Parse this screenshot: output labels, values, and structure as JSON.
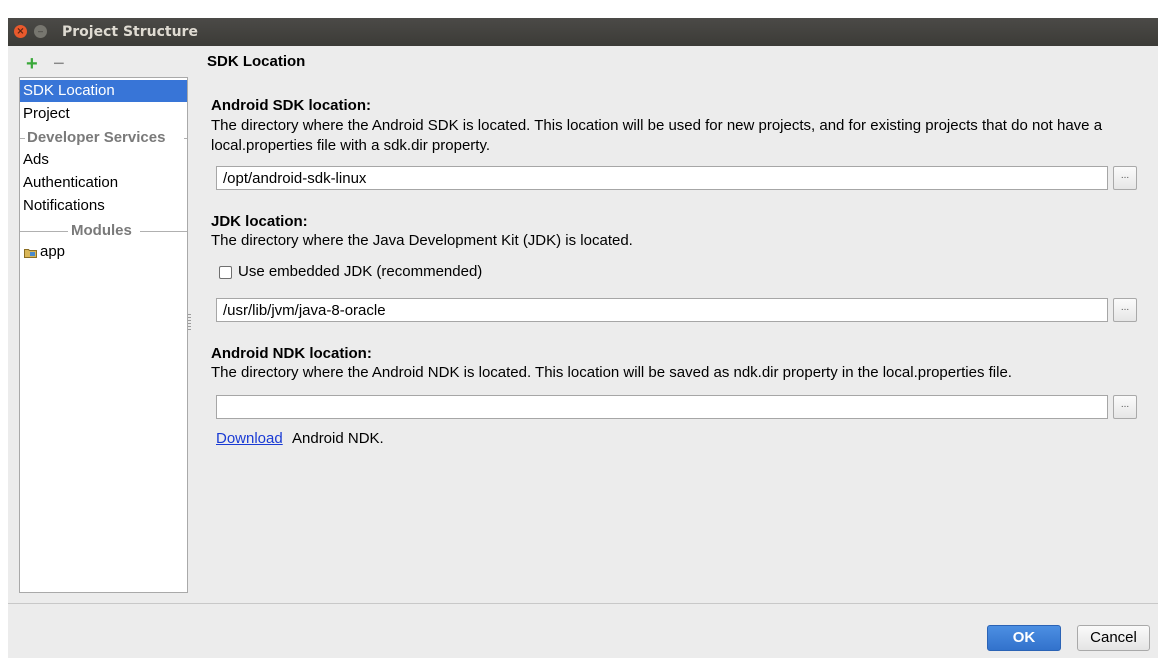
{
  "window": {
    "title": "Project Structure"
  },
  "toolbar": {
    "add": "+",
    "remove": "−"
  },
  "sidebar": {
    "items": [
      "SDK Location",
      "Project"
    ],
    "developer_services_header": "Developer Services",
    "service_items": [
      "Ads",
      "Authentication",
      "Notifications"
    ],
    "modules_header": "Modules",
    "modules": [
      "app"
    ]
  },
  "main": {
    "heading": "SDK Location",
    "android_sdk": {
      "label": "Android SDK location:",
      "description": "The directory where the Android SDK is located. This location will be used for new projects, and for existing projects that do not have a local.properties file with a sdk.dir property.",
      "value": "/opt/android-sdk-linux",
      "browse": "..."
    },
    "jdk": {
      "label": "JDK location:",
      "description": "The directory where the Java Development Kit (JDK) is located.",
      "checkbox_label": "Use embedded JDK (recommended)",
      "checked": false,
      "value": "/usr/lib/jvm/java-8-oracle",
      "browse": "..."
    },
    "ndk": {
      "label": "Android NDK location:",
      "description": "The directory where the Android NDK is located. This location will be saved as ndk.dir property in the local.properties file.",
      "value": "",
      "browse": "...",
      "download_link": "Download",
      "download_text": "Android NDK."
    }
  },
  "buttons": {
    "ok": "OK",
    "cancel": "Cancel"
  },
  "colors": {
    "selection": "#3875d7",
    "accent_ok": "#3a7bd5",
    "link": "#1a3bd4"
  }
}
